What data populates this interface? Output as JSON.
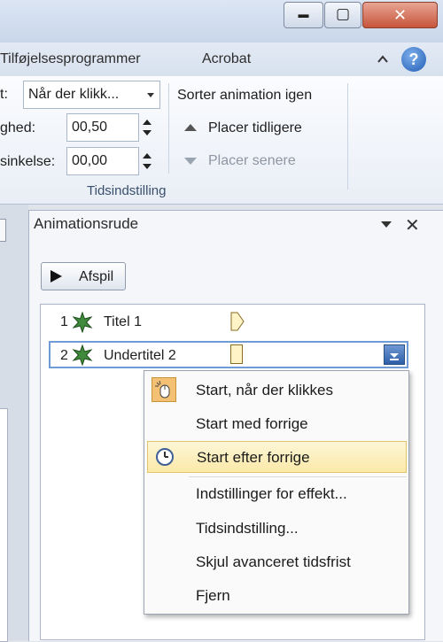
{
  "window_controls": {
    "minimize_glyph": "▬",
    "maximize_glyph": "▢",
    "close_glyph": "✕"
  },
  "tabs": [
    "Tilføjelsesprogrammer",
    "Acrobat"
  ],
  "help_glyph": "?",
  "ribbon": {
    "start_label": "t:",
    "start_value": "Når der klikk...",
    "duration_label": "ghed:",
    "duration_value": "00,50",
    "delay_label": "sinkelse:",
    "delay_value": "00,00",
    "group_caption": "Tidsindstilling",
    "reorder_title": "Sorter animation igen",
    "move_earlier": "Placer tidligere",
    "move_later": "Placer senere"
  },
  "pane": {
    "title": "Animationsrude",
    "play_label": "Afspil",
    "items": [
      {
        "num": "1",
        "label": "Titel 1"
      },
      {
        "num": "2",
        "label": "Undertitel 2"
      }
    ]
  },
  "menu": {
    "items": [
      {
        "label": "Start, når der klikkes",
        "icon": "mouse-click-icon"
      },
      {
        "label": "Start med forrige",
        "icon": ""
      },
      {
        "label": "Start efter forrige",
        "icon": "clock-icon",
        "highlighted": true
      },
      {
        "label": "Indstillinger for effekt...",
        "icon": ""
      },
      {
        "label": "Tidsindstilling...",
        "icon": ""
      },
      {
        "label": "Skjul avanceret tidsfrist",
        "icon": ""
      },
      {
        "label": "Fjern",
        "icon": ""
      }
    ]
  },
  "colors": {
    "highlight": "#fbe9a8",
    "accent": "#2e5fa8",
    "star": "#3f8a3b"
  }
}
